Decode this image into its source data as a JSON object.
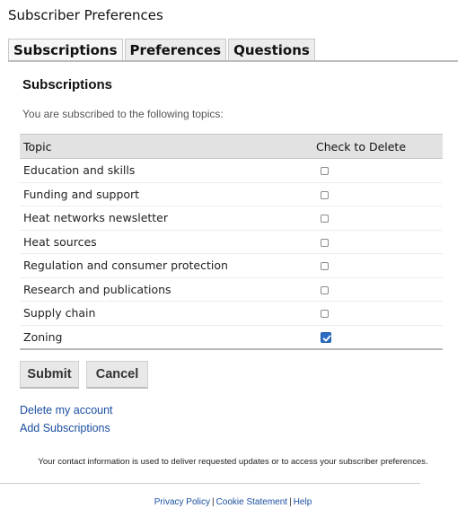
{
  "page_title": "Subscriber Preferences",
  "tabs": [
    {
      "label": "Subscriptions",
      "active": true
    },
    {
      "label": "Preferences",
      "active": false
    },
    {
      "label": "Questions",
      "active": false
    }
  ],
  "section_title": "Subscriptions",
  "intro": "You are subscribed to the following topics:",
  "table": {
    "headers": {
      "topic": "Topic",
      "delete": "Check to Delete"
    },
    "rows": [
      {
        "topic": "Education and skills",
        "checked": false
      },
      {
        "topic": "Funding and support",
        "checked": false
      },
      {
        "topic": "Heat networks newsletter",
        "checked": false
      },
      {
        "topic": "Heat sources",
        "checked": false
      },
      {
        "topic": "Regulation and consumer protection",
        "checked": false
      },
      {
        "topic": "Research and publications",
        "checked": false
      },
      {
        "topic": "Supply chain",
        "checked": false
      },
      {
        "topic": "Zoning",
        "checked": true
      }
    ]
  },
  "buttons": {
    "submit": "Submit",
    "cancel": "Cancel"
  },
  "links": {
    "delete_account": "Delete my account",
    "add_subscriptions": "Add Subscriptions"
  },
  "notice": "Your contact information is used to deliver requested updates or to access your subscriber preferences.",
  "footer": {
    "privacy": "Privacy Policy",
    "cookie": "Cookie Statement",
    "help": "Help",
    "separator": "|"
  },
  "colors": {
    "link": "#1b4fa0",
    "checkbox_checked": "#2b6dc2",
    "header_bg": "#e2e2e2"
  }
}
